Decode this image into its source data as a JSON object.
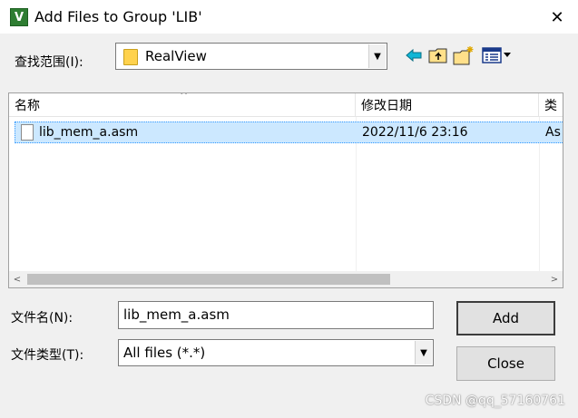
{
  "window": {
    "title": "Add Files to Group 'LIB'",
    "app_icon_letter": "V",
    "close_glyph": "✕"
  },
  "look_in": {
    "label": "查找范围(I):",
    "value": "RealView",
    "icon": "folder-icon",
    "arrow_glyph": "▼"
  },
  "toolbar": [
    {
      "name": "back",
      "icon": "back-arrow-icon"
    },
    {
      "name": "up",
      "icon": "up-folder-icon"
    },
    {
      "name": "new-folder",
      "icon": "new-folder-icon"
    },
    {
      "name": "view-menu",
      "icon": "view-menu-icon"
    }
  ],
  "file_list": {
    "columns": [
      "名称",
      "修改日期",
      "类"
    ],
    "sort_glyph": "^",
    "rows": [
      {
        "name": "lib_mem_a.asm",
        "modified": "2022/11/6 23:16",
        "type": "As"
      }
    ],
    "scroll_left": "<",
    "scroll_right": ">"
  },
  "file_name": {
    "label": "文件名(N):",
    "value": "lib_mem_a.asm"
  },
  "file_type": {
    "label": "文件类型(T):",
    "value": "All files (*.*)",
    "arrow_glyph": "▼"
  },
  "buttons": {
    "add": "Add",
    "close": "Close"
  },
  "watermark": "CSDN @qq_57160761",
  "colors": {
    "selection": "#cce8ff",
    "dialog_bg": "#f0f0f0",
    "accent": "#3399ff"
  }
}
